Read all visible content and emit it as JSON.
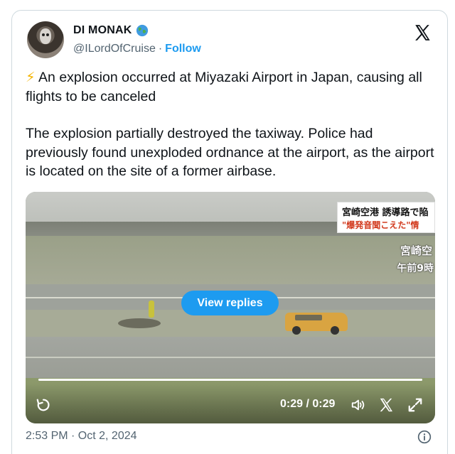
{
  "author": {
    "display_name": "DI MONAK",
    "handle": "@ILordOfCruise",
    "separator": "·",
    "follow_label": "Follow",
    "badge_icon": "globe-icon"
  },
  "platform_icon": "x-logo-icon",
  "tweet": {
    "lead_icon": "⚡",
    "paragraph1": "An explosion occurred at Miyazaki Airport in Japan, causing all flights to be canceled",
    "paragraph2": "The explosion partially destroyed the taxiway. Police had previously found unexploded ordnance at the airport, as the airport is located on the site of a former airbase."
  },
  "media": {
    "news_overlay_line1": "宮崎空港 誘導路で陥",
    "news_overlay_line2": "\"爆発音聞こえた\"情",
    "location_overlay": "宮崎空",
    "time_overlay": "午前9時",
    "view_replies_label": "View replies",
    "timecode": "0:29 / 0:29",
    "progress": 1.0,
    "controls": [
      "replay-icon",
      "volume-icon",
      "x-logo-icon",
      "fullscreen-icon"
    ]
  },
  "footer": {
    "timestamp": "2:53 PM · Oct 2, 2024",
    "info_icon": "info-icon"
  },
  "colors": {
    "accent": "#1d9bf0",
    "text_primary": "#0f1419",
    "text_secondary": "#536471",
    "border": "#cfd9de"
  }
}
